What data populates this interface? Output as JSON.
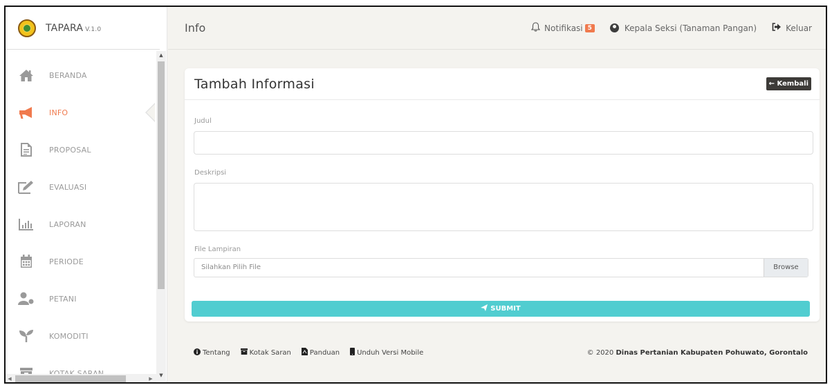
{
  "app": {
    "name": "TAPARA",
    "version": "V.1.0"
  },
  "header": {
    "title": "Info",
    "notifications_label": "Notifikasi",
    "notifications_count": "5",
    "user_label": "Kepala Seksi (Tanaman Pangan)",
    "logout_label": "Keluar"
  },
  "sidebar": {
    "items": [
      {
        "label": "BERANDA",
        "icon": "home-icon",
        "active": false
      },
      {
        "label": "INFO",
        "icon": "megaphone-icon",
        "active": true
      },
      {
        "label": "PROPOSAL",
        "icon": "document-icon",
        "active": false
      },
      {
        "label": "EVALUASI",
        "icon": "edit-icon",
        "active": false
      },
      {
        "label": "LAPORAN",
        "icon": "bar-chart-icon",
        "active": false
      },
      {
        "label": "PERIODE",
        "icon": "calendar-icon",
        "active": false
      },
      {
        "label": "PETANI",
        "icon": "users-icon",
        "active": false
      },
      {
        "label": "KOMODITI",
        "icon": "sprout-icon",
        "active": false
      },
      {
        "label": "KOTAK SARAN",
        "icon": "archive-icon",
        "active": false
      }
    ]
  },
  "form": {
    "title": "Tambah Informasi",
    "back_label": "← Kembali",
    "judul_label": "Judul",
    "judul_value": "",
    "deskripsi_label": "Deskripsi",
    "deskripsi_value": "",
    "file_label": "File Lampiran",
    "file_placeholder": "Silahkan Pilih File",
    "browse_label": "Browse",
    "submit_label": "SUBMIT"
  },
  "footer": {
    "links": [
      "Tentang",
      "Kotak Saran",
      "Panduan",
      "Unduh Versi Mobile"
    ],
    "copyright_prefix": "© 2020",
    "copyright_org": "Dinas Pertanian Kabupaten Pohuwato, Gorontalo"
  },
  "colors": {
    "accent": "#f07a4e",
    "submit": "#51cdd0",
    "back_button": "#3d3b38"
  }
}
